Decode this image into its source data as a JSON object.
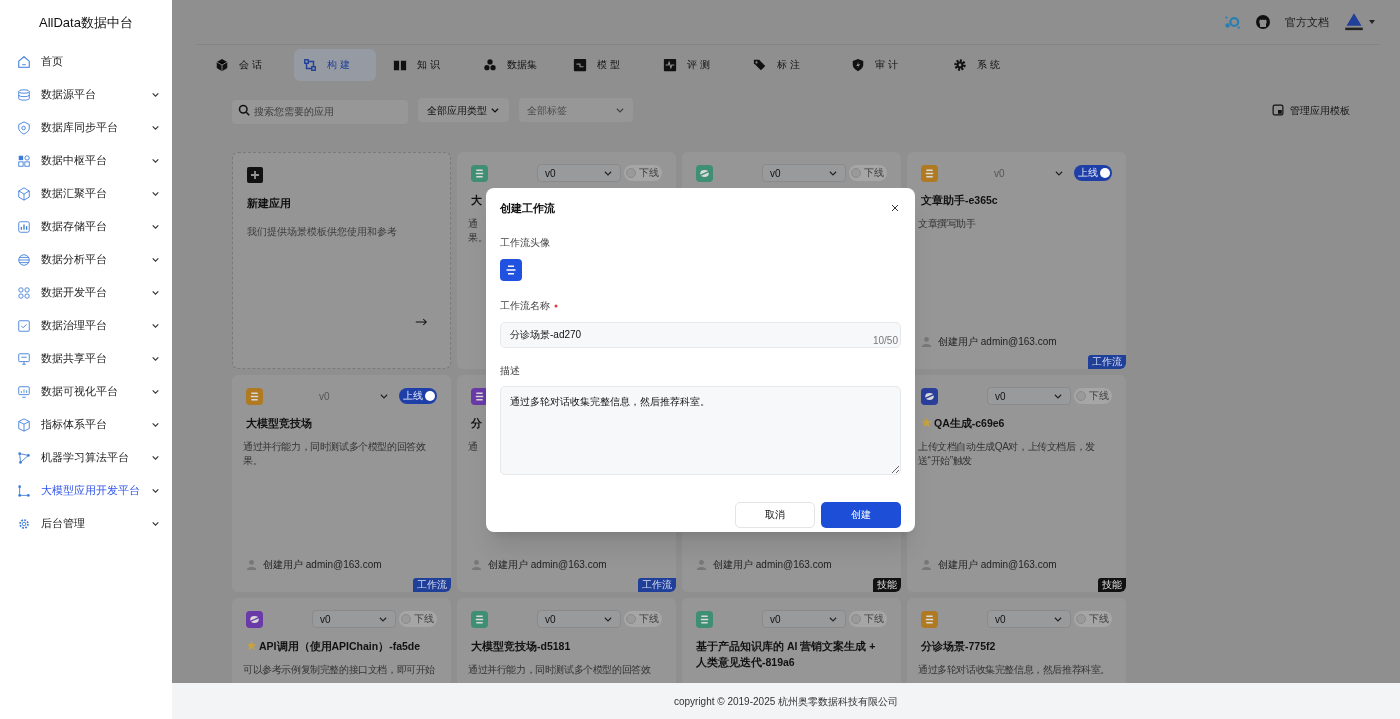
{
  "sidebar": {
    "title": "AllData数据中台",
    "items": [
      {
        "label": "首页",
        "expandable": false,
        "selected": false
      },
      {
        "label": "数据源平台",
        "expandable": true,
        "selected": false
      },
      {
        "label": "数据库同步平台",
        "expandable": true,
        "selected": false
      },
      {
        "label": "数据中枢平台",
        "expandable": true,
        "selected": false
      },
      {
        "label": "数据汇聚平台",
        "expandable": true,
        "selected": false
      },
      {
        "label": "数据存储平台",
        "expandable": true,
        "selected": false
      },
      {
        "label": "数据分析平台",
        "expandable": true,
        "selected": false
      },
      {
        "label": "数据开发平台",
        "expandable": true,
        "selected": false
      },
      {
        "label": "数据治理平台",
        "expandable": true,
        "selected": false
      },
      {
        "label": "数据共享平台",
        "expandable": true,
        "selected": false
      },
      {
        "label": "数据可视化平台",
        "expandable": true,
        "selected": false
      },
      {
        "label": "指标体系平台",
        "expandable": true,
        "selected": false
      },
      {
        "label": "机器学习算法平台",
        "expandable": true,
        "selected": false
      },
      {
        "label": "大模型应用开发平台",
        "expandable": true,
        "selected": true
      },
      {
        "label": "后台管理",
        "expandable": true,
        "selected": false
      }
    ]
  },
  "header": {
    "docs_link": "官方文档"
  },
  "tabs": [
    {
      "label": "会 话",
      "selected": false
    },
    {
      "label": "构 建",
      "selected": true
    },
    {
      "label": "知 识",
      "selected": false
    },
    {
      "label": "数据集",
      "selected": false
    },
    {
      "label": "模 型",
      "selected": false
    },
    {
      "label": "评 测",
      "selected": false
    },
    {
      "label": "标 注",
      "selected": false
    },
    {
      "label": "审 计",
      "selected": false
    },
    {
      "label": "系 统",
      "selected": false
    }
  ],
  "toolbar": {
    "search_placeholder": "搜索您需要的应用",
    "type_filter": "全部应用类型",
    "tag_filter_placeholder": "全部标签",
    "manage_button": "管理应用模板"
  },
  "new_app_card": {
    "title": "新建应用",
    "description": "我们提供场景模板供您使用和参考"
  },
  "apps": [
    {
      "icon": {
        "kind": "lines",
        "color": "#3f8f74"
      },
      "version": "v0",
      "online": false,
      "toggle_label": "下线",
      "title": "大",
      "starred": false,
      "description": [
        "通",
        "果。"
      ]
    },
    {
      "icon": {
        "kind": "planet",
        "color": "#3f8f74"
      },
      "version": "v0",
      "online": false,
      "toggle_label": "下线"
    },
    {
      "icon": {
        "kind": "lines",
        "color": "#b07a22"
      },
      "version": "v0",
      "online": true,
      "toggle_label": "上线",
      "title": "文章助手-e365c",
      "starred": false,
      "description": [
        "文章撰写助手"
      ],
      "creator_label": "创建用户",
      "creator": "admin@163.com",
      "badge": {
        "kind": "workflow",
        "label": "工作流"
      }
    },
    {
      "icon": {
        "kind": "lines",
        "color": "#b07a22"
      },
      "version": "v0",
      "online": true,
      "toggle_label": "上线",
      "title": "大模型竞技场",
      "starred": false,
      "description": [
        "通过并行能力，同时测试多个模型的回答效果。"
      ],
      "creator_label": "创建用户",
      "creator": "admin@163.com",
      "badge": {
        "kind": "workflow",
        "label": "工作流"
      }
    },
    {
      "icon": {
        "kind": "lines",
        "color": "#6a3aa8"
      },
      "title": "分",
      "starred": false,
      "description": [
        "通"
      ],
      "creator_label": "创建用户",
      "creator": "admin@163.com",
      "badge": {
        "kind": "workflow",
        "label": "工作流"
      }
    },
    {
      "creator_label": "创建用户",
      "creator": "admin@163.com",
      "badge": {
        "kind": "skill",
        "label": "技能"
      }
    },
    {
      "icon": {
        "kind": "planet",
        "color": "#2a3f9a"
      },
      "version": "v0",
      "online": false,
      "toggle_label": "下线",
      "title": "QA生成-c69e6",
      "starred": true,
      "description": [
        "上传文档自动生成QA对，上传文档后，发送“开始”触发"
      ],
      "creator_label": "创建用户",
      "creator": "admin@163.com",
      "badge": {
        "kind": "skill",
        "label": "技能"
      }
    },
    {
      "icon": {
        "kind": "planet",
        "color": "#6a3aa8"
      },
      "version": "v0",
      "online": false,
      "toggle_label": "下线",
      "title": "API调用（使用APIChain）-fa5de",
      "starred": true,
      "description": [
        "可以参考示例复制完整的接口文档，即可开始"
      ]
    },
    {
      "icon": {
        "kind": "lines",
        "color": "#3f8f74"
      },
      "version": "v0",
      "online": false,
      "toggle_label": "下线",
      "title": "大模型竞技场-d5181",
      "starred": false,
      "description": [
        "通过并行能力，同时测试多个模型的回答效"
      ]
    },
    {
      "icon": {
        "kind": "lines",
        "color": "#3f8f74"
      },
      "version": "v0",
      "online": false,
      "toggle_label": "下线",
      "title": "基于产品知识库的 AI 营销文案生成 + 人类意见迭代-819a6",
      "starred": false
    },
    {
      "icon": {
        "kind": "lines",
        "color": "#b07a22"
      },
      "version": "v0",
      "online": false,
      "toggle_label": "下线",
      "title": "分诊场景-775f2",
      "starred": false,
      "description": [
        "通过多轮对话收集完整信息，然后推荐科室。"
      ]
    }
  ],
  "modal": {
    "title": "创建工作流",
    "avatar_label": "工作流头像",
    "name_label": "工作流名称",
    "name_required": true,
    "name_value": "分诊场景-ad270",
    "name_counter": "10/50",
    "description_label": "描述",
    "description_value": "通过多轮对话收集完整信息，然后推荐科室。",
    "cancel_button": "取消",
    "create_button": "创建"
  },
  "footer": {
    "copyright": "copyright © 2019-2025 杭州奥零数据科技有限公司"
  }
}
